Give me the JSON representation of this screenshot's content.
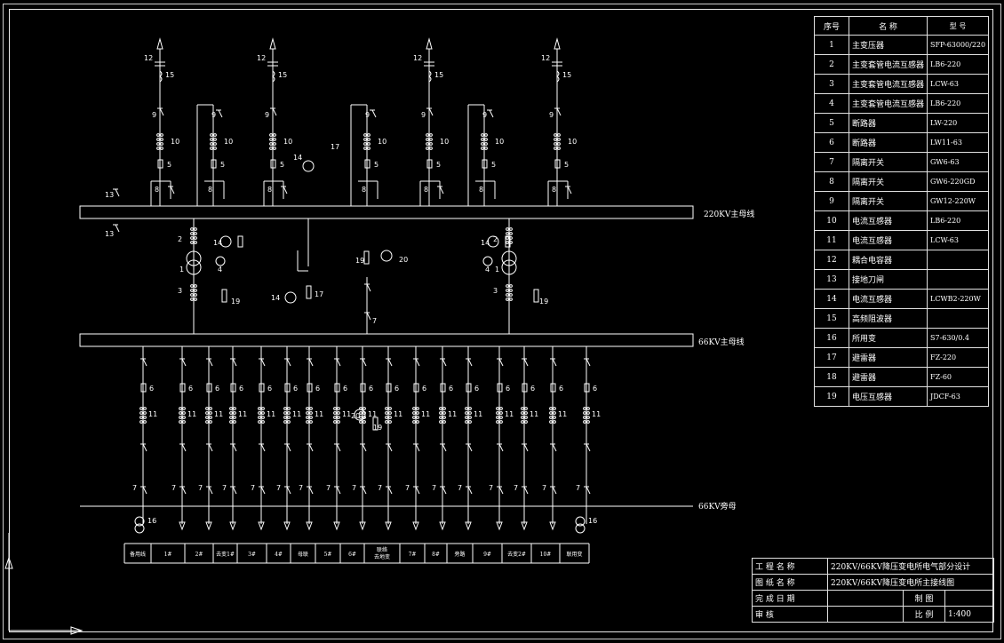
{
  "diagram": {
    "bus_220": "220KV主母线",
    "bus_66": "66KV主母线",
    "bus_bypass": "66KV旁母",
    "feeders": [
      "备用线",
      "1#",
      "2#",
      "去变1#",
      "3#",
      "4#",
      "母联",
      "5#",
      "6#",
      "联络\n去地变",
      "7#",
      "8#",
      "旁路",
      "9#",
      "去变2#",
      "10#",
      "联用变"
    ]
  },
  "legend": {
    "headers": [
      "序号",
      "名 称",
      "型 号"
    ],
    "rows": [
      [
        "1",
        "主变压器",
        "SFP-63000/220"
      ],
      [
        "2",
        "主变套管电流互感器",
        "LB6-220"
      ],
      [
        "3",
        "主变套管电流互感器",
        "LCW-63"
      ],
      [
        "4",
        "主变套管电流互感器",
        "LB6-220"
      ],
      [
        "5",
        "断路器",
        "LW-220"
      ],
      [
        "6",
        "断路器",
        "LW11-63"
      ],
      [
        "7",
        "隔离开关",
        "GW6-63"
      ],
      [
        "8",
        "隔离开关",
        "GW6-220GD"
      ],
      [
        "9",
        "隔离开关",
        "GW12-220W"
      ],
      [
        "10",
        "电流互感器",
        "LB6-220"
      ],
      [
        "11",
        "电流互感器",
        "LCW-63"
      ],
      [
        "12",
        "耦合电容器",
        ""
      ],
      [
        "13",
        "接地刀闸",
        ""
      ],
      [
        "14",
        "电流互感器",
        "LCWB2-220W"
      ],
      [
        "15",
        "高频阻波器",
        ""
      ],
      [
        "16",
        "所用变",
        "S7-630/0.4"
      ],
      [
        "17",
        "避雷器",
        "FZ-220"
      ],
      [
        "18",
        "避雷器",
        "FZ-60"
      ],
      [
        "19",
        "电压互感器",
        "JDCF-63"
      ]
    ]
  },
  "title_block": {
    "project_label": "工 程 名 称",
    "project_value": "220KV/66KV降压变电所电气部分设计",
    "drawing_label": "图 纸 名 称",
    "drawing_value": "220KV/66KV降压变电所主接线图",
    "date_label": "完 成 日 期",
    "drawn_label": "制 图",
    "review_label": "审 核",
    "scale_label": "比 例",
    "scale_value": "1:400"
  },
  "colors": {
    "line": "#ffffff",
    "background": "#000000"
  }
}
